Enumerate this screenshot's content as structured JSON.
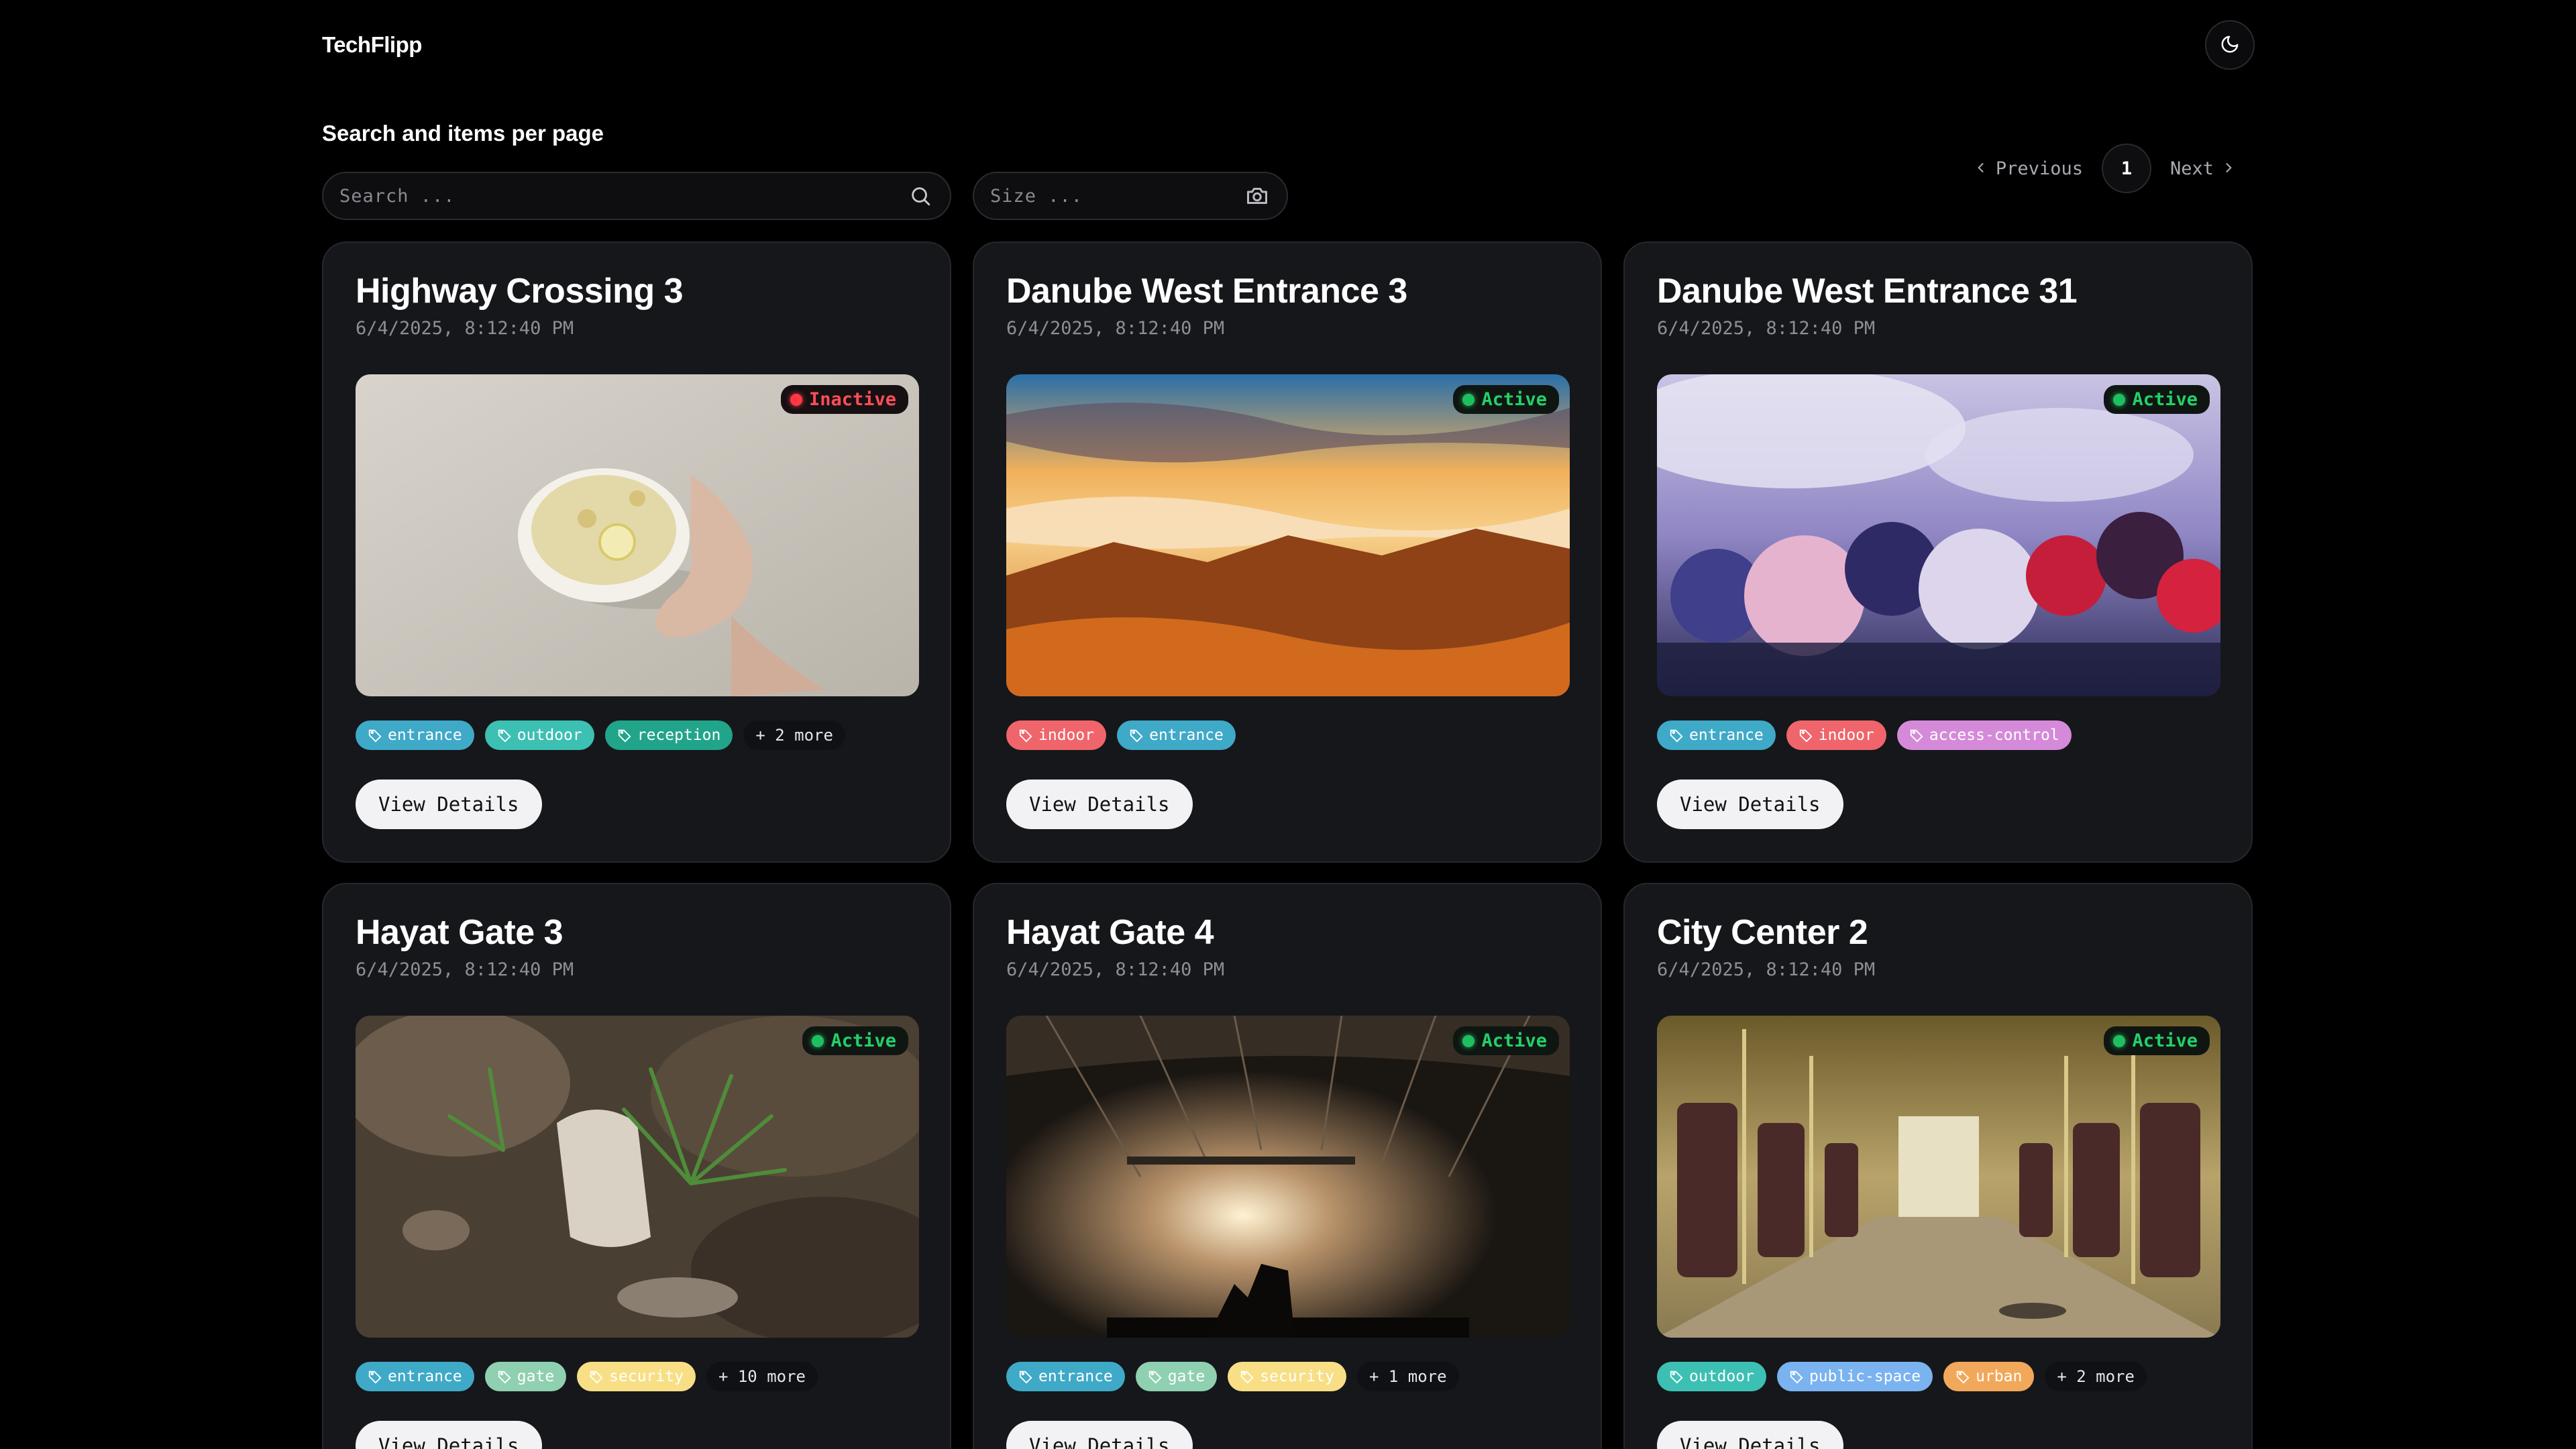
{
  "app": {
    "brand": "TechFlipp"
  },
  "header": {
    "theme_toggle_icon": "moon-icon"
  },
  "controls": {
    "section_title": "Search and items per page",
    "search_placeholder": "Search ...",
    "size_placeholder": "Size ..."
  },
  "pagination": {
    "previous": "Previous",
    "current": "1",
    "next": "Next"
  },
  "colors": {
    "tag_entrance": "#3fa9c8",
    "tag_outdoor": "#3cc0b3",
    "tag_reception": "#21a58a",
    "tag_indoor": "#f0656b",
    "tag_access_control": "#d58ad9",
    "tag_gate": "#8fd0b0",
    "tag_security": "#f8df86",
    "tag_public_space": "#7ab3f0",
    "tag_urban": "#f2a85a",
    "status_active": "#22d06a",
    "status_inactive": "#ff4d57"
  },
  "cards": [
    {
      "title": "Highway Crossing 3",
      "date": "6/4/2025, 8:12:40 PM",
      "status": "Inactive",
      "tags": [
        "entrance",
        "outdoor",
        "reception"
      ],
      "more": "+ 2 more",
      "button": "View Details"
    },
    {
      "title": "Danube West Entrance 3",
      "date": "6/4/2025, 8:12:40 PM",
      "status": "Active",
      "tags": [
        "indoor",
        "entrance"
      ],
      "more": "",
      "button": "View Details"
    },
    {
      "title": "Danube West Entrance 31",
      "date": "6/4/2025, 8:12:40 PM",
      "status": "Active",
      "tags": [
        "entrance",
        "indoor",
        "access-control"
      ],
      "more": "",
      "button": "View Details"
    },
    {
      "title": "Hayat Gate 3",
      "date": "6/4/2025, 8:12:40 PM",
      "status": "Active",
      "tags": [
        "entrance",
        "gate",
        "security"
      ],
      "more": "+ 10 more",
      "button": "View Details"
    },
    {
      "title": "Hayat Gate 4",
      "date": "6/4/2025, 8:12:40 PM",
      "status": "Active",
      "tags": [
        "entrance",
        "gate",
        "security"
      ],
      "more": "+ 1 more",
      "button": "View Details"
    },
    {
      "title": "City Center 2",
      "date": "6/4/2025, 8:12:40 PM",
      "status": "Active",
      "tags": [
        "outdoor",
        "public-space",
        "urban"
      ],
      "more": "+ 2 more",
      "button": "View Details"
    }
  ]
}
